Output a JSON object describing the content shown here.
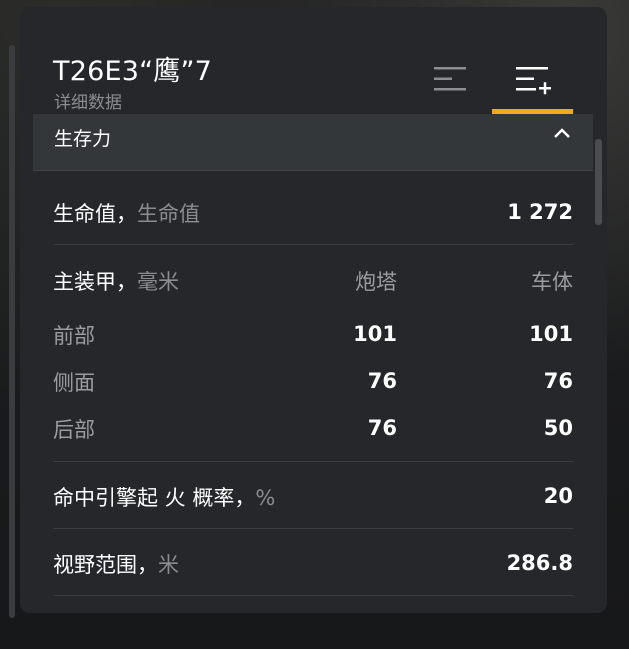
{
  "header": {
    "title": "T26E3“鹰”7",
    "subtitle": "详细数据"
  },
  "tabs": [
    {
      "icon": "compact-list-icon",
      "active": false
    },
    {
      "icon": "expanded-list-icon",
      "active": true
    }
  ],
  "colors": {
    "accent": "#f5a623",
    "panel": "#25272a",
    "section_header": "#34373a",
    "muted_text": "#8a8d90"
  },
  "section": {
    "title": "生存力",
    "collapse_icon": "chevron-up-icon"
  },
  "hit_points": {
    "label": "生命值，",
    "unit": "生命值",
    "value": "1 272"
  },
  "armor": {
    "label": "主装甲，",
    "unit": "毫米",
    "col_turret": "炮塔",
    "col_hull": "车体",
    "rows": [
      {
        "label": "前部",
        "turret": "101",
        "hull": "101"
      },
      {
        "label": "侧面",
        "turret": "76",
        "hull": "76"
      },
      {
        "label": "后部",
        "turret": "76",
        "hull": "50"
      }
    ]
  },
  "engine_fire": {
    "label": "命中引擎起 火 概率，",
    "unit": "%",
    "value": "20"
  },
  "view_range": {
    "label": "视野范围，",
    "unit": "米",
    "value": "286.8"
  }
}
